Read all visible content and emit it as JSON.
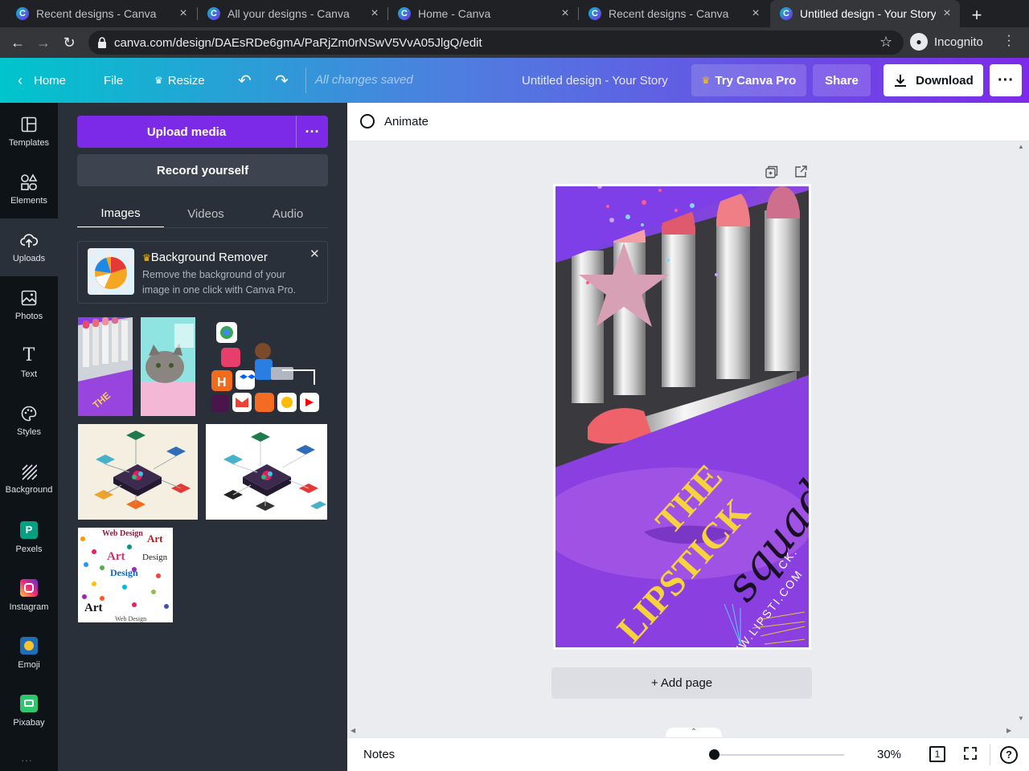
{
  "browser": {
    "tabs": [
      {
        "title": "Recent designs - Canva",
        "active": false
      },
      {
        "title": "All your designs - Canva",
        "active": false
      },
      {
        "title": "Home - Canva",
        "active": false
      },
      {
        "title": "Recent designs - Canva",
        "active": false
      },
      {
        "title": "Untitled design - Your Story",
        "active": true
      }
    ],
    "favicon_letter": "C",
    "new_tab": "+",
    "url": "canva.com/design/DAEsRDe6gmA/PaRjZm0rNSwV5VvA05JlgQ/edit",
    "incognito_label": "Incognito"
  },
  "header": {
    "home": "Home",
    "file": "File",
    "resize": "Resize",
    "status": "All changes saved",
    "title": "Untitled design - Your Story",
    "try_pro": "Try Canva Pro",
    "share": "Share",
    "download": "Download",
    "gradient": [
      "#00c4cc",
      "#7d2ae8"
    ]
  },
  "rail": [
    {
      "label": "Templates",
      "icon": "templates-icon"
    },
    {
      "label": "Elements",
      "icon": "elements-icon"
    },
    {
      "label": "Uploads",
      "icon": "uploads-icon",
      "active": true
    },
    {
      "label": "Photos",
      "icon": "photos-icon"
    },
    {
      "label": "Text",
      "icon": "text-icon"
    },
    {
      "label": "Styles",
      "icon": "styles-icon"
    },
    {
      "label": "Background",
      "icon": "background-icon"
    },
    {
      "label": "Pexels",
      "icon": "pexels-icon",
      "color": "#05a081"
    },
    {
      "label": "Instagram",
      "icon": "instagram-icon",
      "color": "#c13584"
    },
    {
      "label": "Emoji",
      "icon": "emoji-icon",
      "color": "#1e6fb8"
    },
    {
      "label": "Pixabay",
      "icon": "pixabay-icon",
      "color": "#2ec66d"
    }
  ],
  "panel": {
    "upload_button": "Upload media",
    "record_button": "Record yourself",
    "tabs": [
      "Images",
      "Videos",
      "Audio"
    ],
    "active_tab": "Images",
    "bg_remover": {
      "title": "Background Remover",
      "description": "Remove the background of your image in one click with Canva Pro."
    },
    "accent": "#7d2ae8"
  },
  "workspace": {
    "animate": "Animate",
    "add_page": "+ Add page",
    "design_text": {
      "line1": "THE",
      "line2": "LIPSTICK",
      "script": "squad",
      "url": "WWW.LIPSTI.COM",
      "ck": "CK."
    }
  },
  "footer": {
    "notes": "Notes",
    "zoom": "30%",
    "page_count": "1",
    "help": "?"
  }
}
